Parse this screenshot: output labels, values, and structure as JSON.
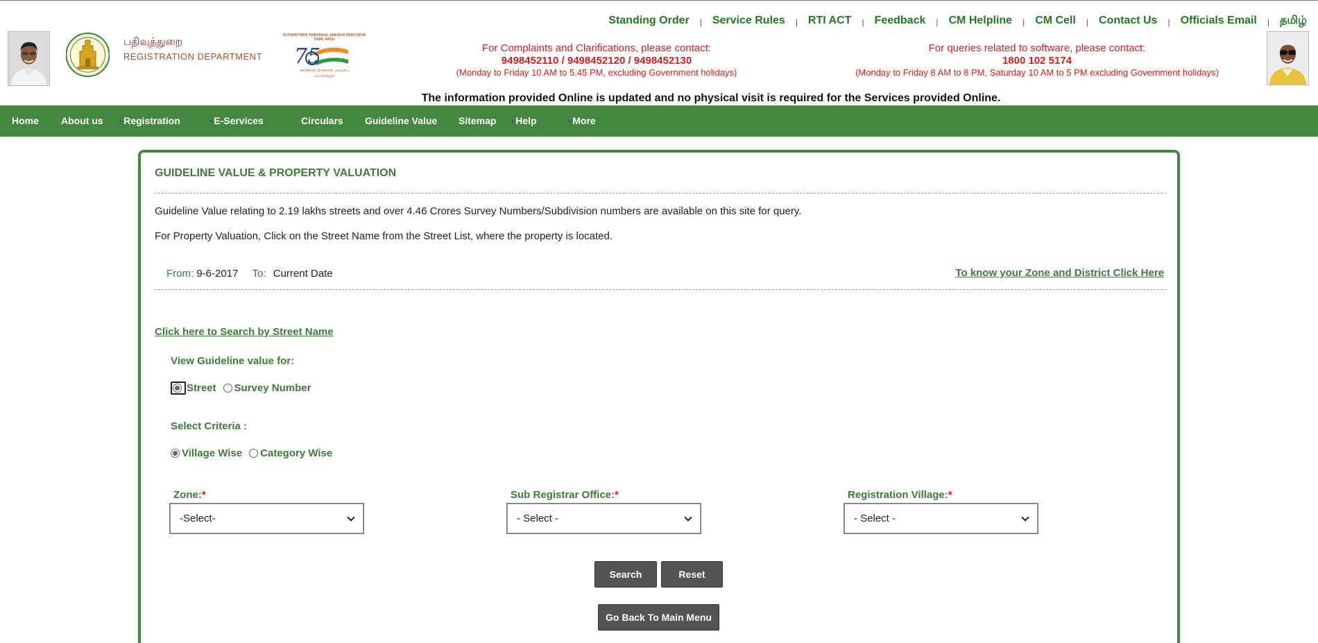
{
  "top_links": [
    {
      "label": "Standing Order"
    },
    {
      "label": "Service Rules"
    },
    {
      "label": "RTI ACT"
    },
    {
      "label": "Feedback"
    },
    {
      "label": "CM Helpline"
    },
    {
      "label": "CM Cell"
    },
    {
      "label": "Contact Us"
    },
    {
      "label": "Officials Email"
    },
    {
      "label": "தமிழ்"
    }
  ],
  "header": {
    "dept_tamil": "பதிவுத்துறை",
    "dept_english": "REGISTRATION DEPARTMENT",
    "azadi_text": "SUTHANTHIRA THIRUNAAL AMUDHA PERUVIZHA TAMIL NADU",
    "azadi_tamil": "சுதந்திரத் திருநாள் அமுதப் பெருவிழா",
    "complaints": {
      "title": "For Complaints and Clarifications, please contact:",
      "numbers": "9498452110 / 9498452120 / 9498452130",
      "hours": "(Monday to Friday 10 AM to 5.45 PM, excluding Government holidays)"
    },
    "software": {
      "title": "For queries related to software, please contact:",
      "numbers": "1800 102 5174",
      "hours": "(Monday to Friday 8 AM to 8 PM, Saturday 10 AM to 5 PM excluding Government holidays)"
    },
    "notice": "The information provided Online is updated and no physical visit is required for the Services provided Online."
  },
  "nav": {
    "home": "Home",
    "about": "About us",
    "registration": "Registration",
    "eservices": "E-Services",
    "circulars": "Circulars",
    "guideline": "Guideline Value",
    "sitemap": "Sitemap",
    "help": "Help",
    "more": "More"
  },
  "panel": {
    "title": "GUIDELINE VALUE & PROPERTY VALUATION",
    "info1": "Guideline Value relating to 2.19 lakhs streets and over 4.46 Crores Survey Numbers/Subdivision numbers are available on this site for query.",
    "info2": "For Property Valuation, Click on the Street Name from the Street List, where the property is located.",
    "from_label": "From:",
    "from_value": "9-6-2017",
    "to_label": "To:",
    "to_value": "Current Date",
    "zone_link": "To know your Zone and District Click Here",
    "street_link": "Click here to Search by Street Name",
    "view_label": "View Guideline value for:",
    "view_options": {
      "street": "Street",
      "survey": "Survey Number",
      "selected": "Street"
    },
    "criteria_label": "Select Criteria :",
    "criteria_options": {
      "village": "Village Wise",
      "category": "Category Wise",
      "selected": "Village Wise"
    },
    "zone": {
      "label": "Zone:",
      "required": "*",
      "value": "-Select-"
    },
    "sro": {
      "label": "Sub Registrar Office:",
      "required": "*",
      "value": "- Select -"
    },
    "village": {
      "label": "Registration Village:",
      "required": "*",
      "value": "- Select -"
    },
    "search_btn": "Search",
    "reset_btn": "Reset",
    "back_btn": "Go Back To Main Menu"
  },
  "colors": {
    "brand_green": "#43883e",
    "text_green": "#3d7b39",
    "alert_red": "#d41e1e"
  }
}
